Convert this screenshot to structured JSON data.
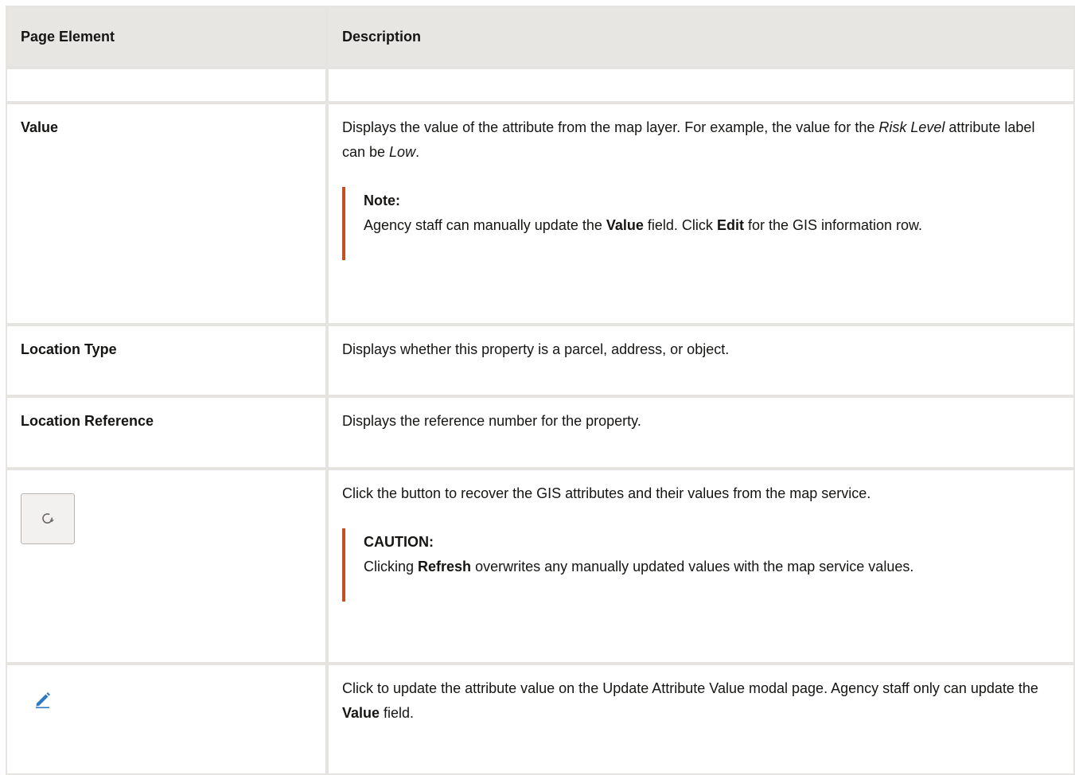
{
  "table": {
    "headers": [
      "Page Element",
      "Description"
    ],
    "rows": {
      "value": {
        "element": "Value",
        "desc_part1": "Displays the value of the attribute from the map layer. For example, the value for the ",
        "desc_em1": "Risk Level",
        "desc_part2": " attribute label can be ",
        "desc_em2": "Low",
        "desc_part3": ".",
        "note_title": "Note:",
        "note_part1": "Agency staff can manually update the ",
        "note_bold1": "Value",
        "note_part2": " field. Click ",
        "note_bold2": "Edit",
        "note_part3": " for the GIS information row."
      },
      "location_type": {
        "element": "Location Type",
        "desc": "Displays whether this property is a parcel, address, or object."
      },
      "location_reference": {
        "element": "Location Reference",
        "desc": "Displays the reference number for the property."
      },
      "refresh": {
        "icon": "refresh-icon",
        "desc": "Click the button to recover the GIS attributes and their values from the map service.",
        "caution_title": "CAUTION:",
        "caution_part1": "Clicking ",
        "caution_bold": "Refresh",
        "caution_part2": " overwrites any manually updated values with the map service values."
      },
      "edit": {
        "icon": "pencil-edit-icon",
        "desc_part1": "Click to update the attribute value on the Update Attribute Value modal page. Agency staff only can update the ",
        "desc_bold": "Value",
        "desc_part2": " field."
      }
    }
  },
  "colors": {
    "header_bg": "#e8e6e3",
    "border": "#e6e4e1",
    "note_accent": "#c2511f",
    "edit_icon": "#2f78c4"
  }
}
